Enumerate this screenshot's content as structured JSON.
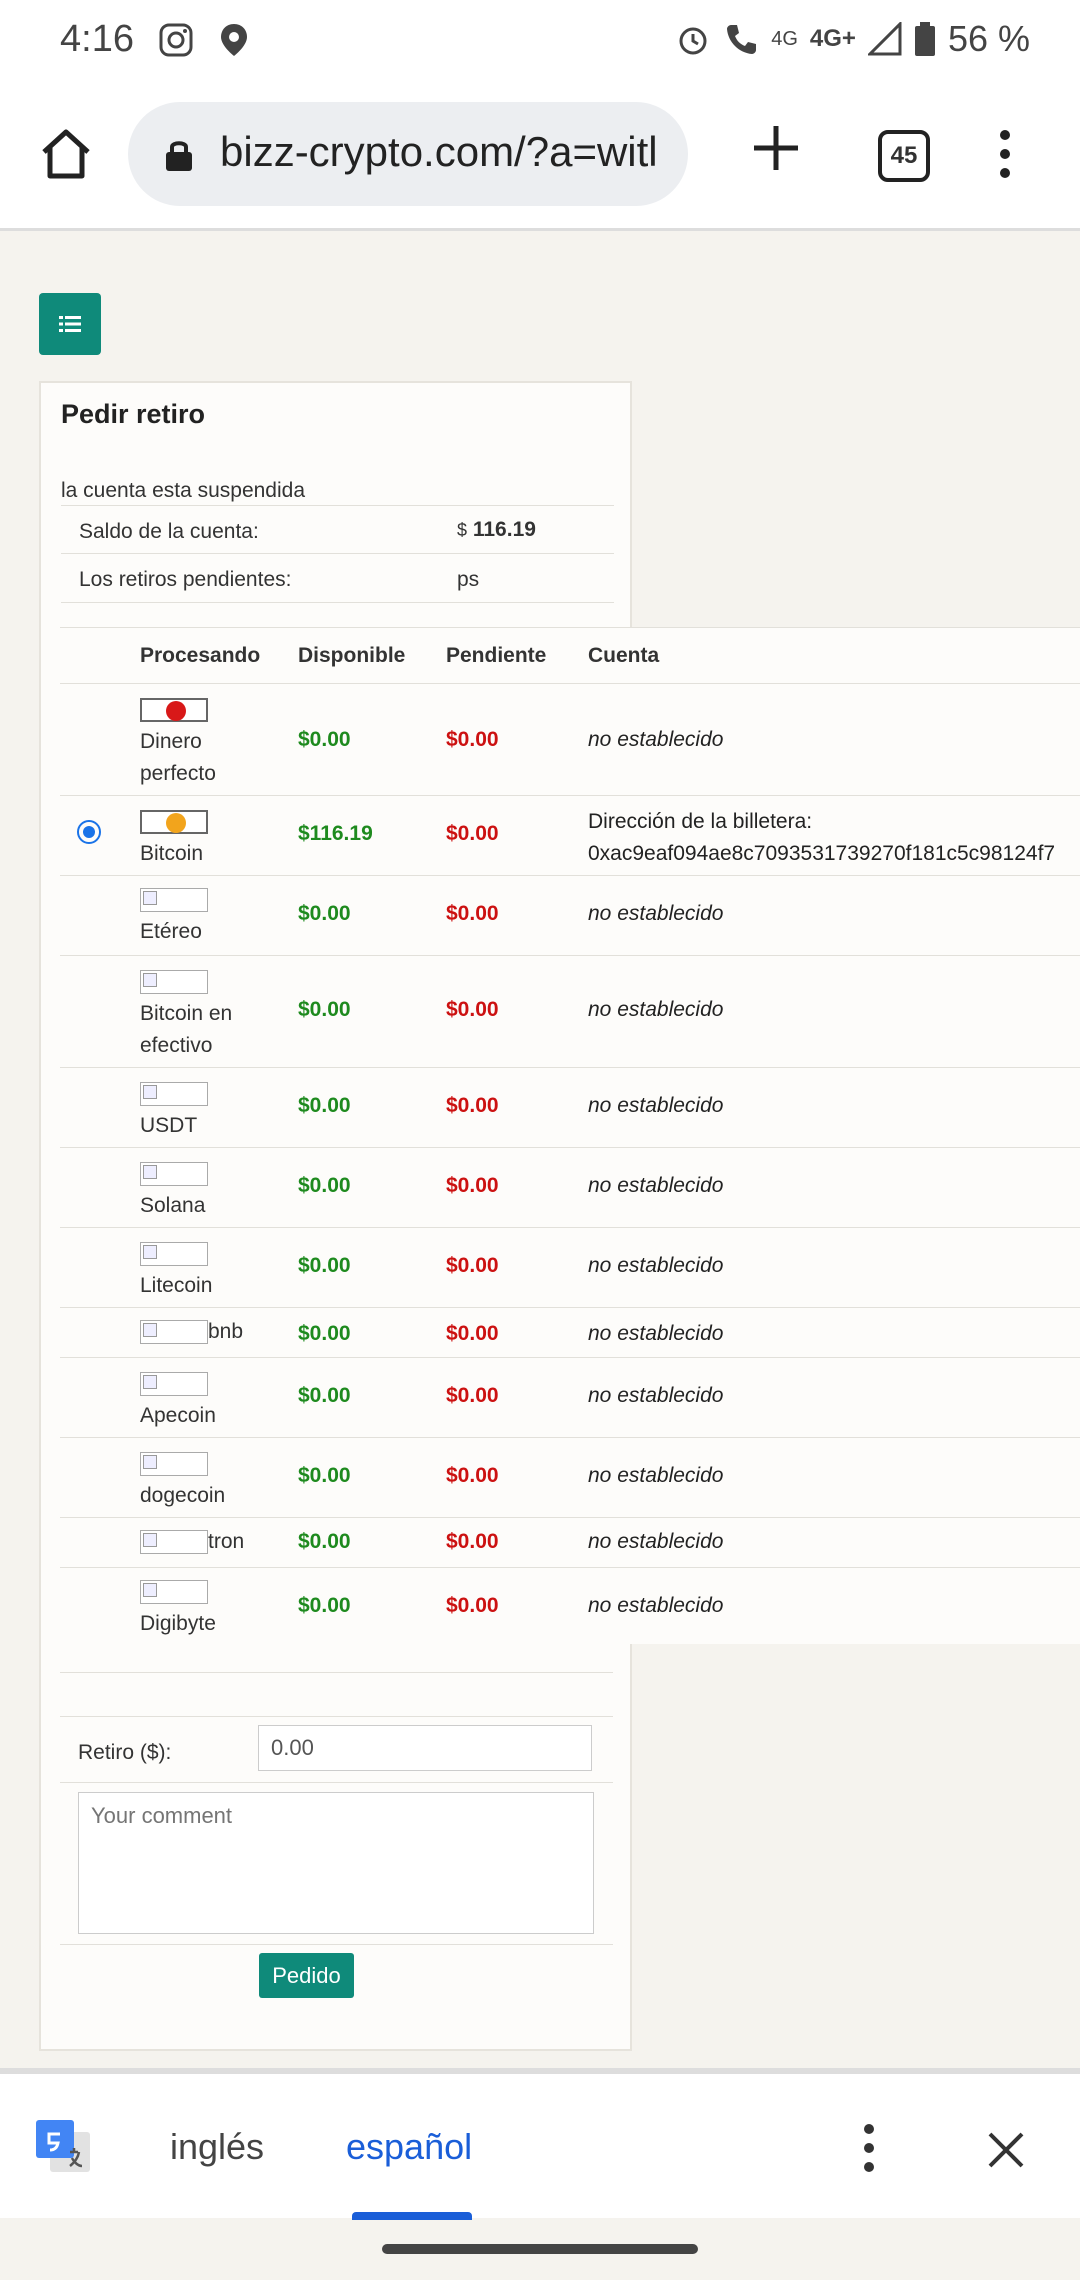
{
  "status_bar": {
    "time": "4:16",
    "network_1": "4G",
    "network_2": "4G+",
    "battery": "56 %"
  },
  "browser": {
    "url": "bizz-crypto.com/?a=witl",
    "tab_count": "45"
  },
  "card": {
    "title": "Pedir retiro",
    "notice": "la cuenta esta suspendida",
    "balance_label": "Saldo de la cuenta:",
    "balance_currency": "$",
    "balance_value": "116.19",
    "pending_label": "Los retiros pendientes:",
    "pending_value": "ps"
  },
  "table": {
    "headers": {
      "processing": "Procesando",
      "available": "Disponible",
      "pending": "Pendiente",
      "account": "Cuenta"
    },
    "rows": [
      {
        "name": "Dinero perfecto",
        "available": "$0.00",
        "pending": "$0.00",
        "account": "no establecido",
        "icon": "perfect-money-icon"
      },
      {
        "name": "Bitcoin",
        "available": "$116.19",
        "pending": "$0.00",
        "account_label": "Dirección de la billetera:",
        "account": "0xac9eaf094ae8c7093531739270f181c5c98124f7",
        "icon": "bitcoin-icon",
        "selected": true
      },
      {
        "name": "Etéreo",
        "available": "$0.00",
        "pending": "$0.00",
        "account": "no establecido"
      },
      {
        "name": "Bitcoin en efectivo",
        "available": "$0.00",
        "pending": "$0.00",
        "account": "no establecido"
      },
      {
        "name": "USDT",
        "available": "$0.00",
        "pending": "$0.00",
        "account": "no establecido"
      },
      {
        "name": "Solana",
        "available": "$0.00",
        "pending": "$0.00",
        "account": "no establecido"
      },
      {
        "name": "Litecoin",
        "available": "$0.00",
        "pending": "$0.00",
        "account": "no establecido"
      },
      {
        "name": "bnb",
        "available": "$0.00",
        "pending": "$0.00",
        "account": "no establecido"
      },
      {
        "name": "Apecoin",
        "available": "$0.00",
        "pending": "$0.00",
        "account": "no establecido"
      },
      {
        "name": "dogecoin",
        "available": "$0.00",
        "pending": "$0.00",
        "account": "no establecido"
      },
      {
        "name": "tron",
        "available": "$0.00",
        "pending": "$0.00",
        "account": "no establecido"
      },
      {
        "name": "Digibyte",
        "available": "$0.00",
        "pending": "$0.00",
        "account": "no establecido"
      }
    ]
  },
  "form": {
    "withdraw_label": "Retiro ($):",
    "amount_value": "0.00",
    "comment_placeholder": "Your comment",
    "submit_label": "Pedido"
  },
  "translate_bar": {
    "source_lang": "inglés",
    "target_lang": "español"
  },
  "colors": {
    "accent": "#0f8a7a",
    "positive": "#1e8a1e",
    "negative": "#cc1111",
    "link_blue": "#1a5ed8"
  }
}
